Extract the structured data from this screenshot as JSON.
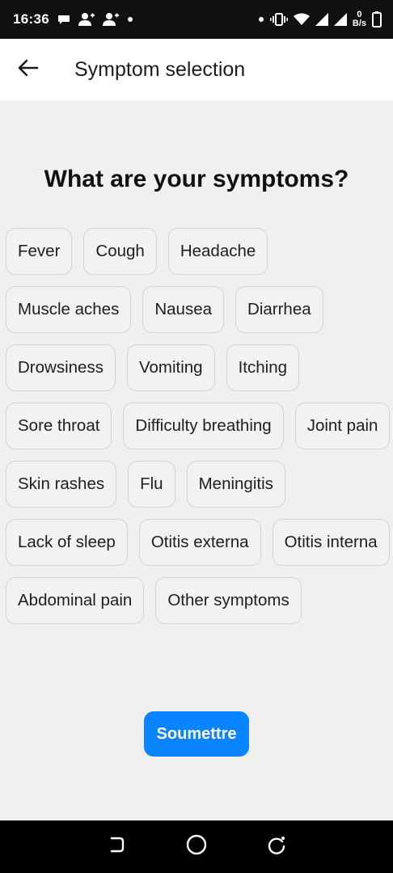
{
  "status_bar": {
    "time": "16:36",
    "net_speed_value": "0",
    "net_speed_unit": "B/s",
    "icons": [
      "chat-bubble-icon",
      "person-add-icon",
      "person-add-icon",
      "dot-icon",
      "dot-icon",
      "vibrate-icon",
      "wifi-icon",
      "signal-icon",
      "signal-icon",
      "battery-icon"
    ]
  },
  "app_bar": {
    "title": "Symptom selection",
    "back_icon": "arrow-left-icon"
  },
  "main": {
    "heading": "What are your symptoms?",
    "symptoms": [
      "Fever",
      "Cough",
      "Headache",
      "Muscle aches",
      "Nausea",
      "Diarrhea",
      "Drowsiness",
      "Vomiting",
      "Itching",
      "Sore throat",
      "Difficulty breathing",
      "Joint pain",
      "Skin rashes",
      "Flu",
      "Meningitis",
      "Lack of sleep",
      "Otitis externa",
      "Otitis interna",
      "Abdominal pain",
      "Other symptoms"
    ],
    "submit_label": "Soumettre"
  },
  "colors": {
    "accent": "#0a84ff",
    "background": "#f0f0f0",
    "status_bar": "#111111",
    "nav_bar": "#000000"
  },
  "nav_bar": {
    "icons": [
      "back-nav-icon",
      "home-nav-icon",
      "recents-nav-icon"
    ]
  }
}
